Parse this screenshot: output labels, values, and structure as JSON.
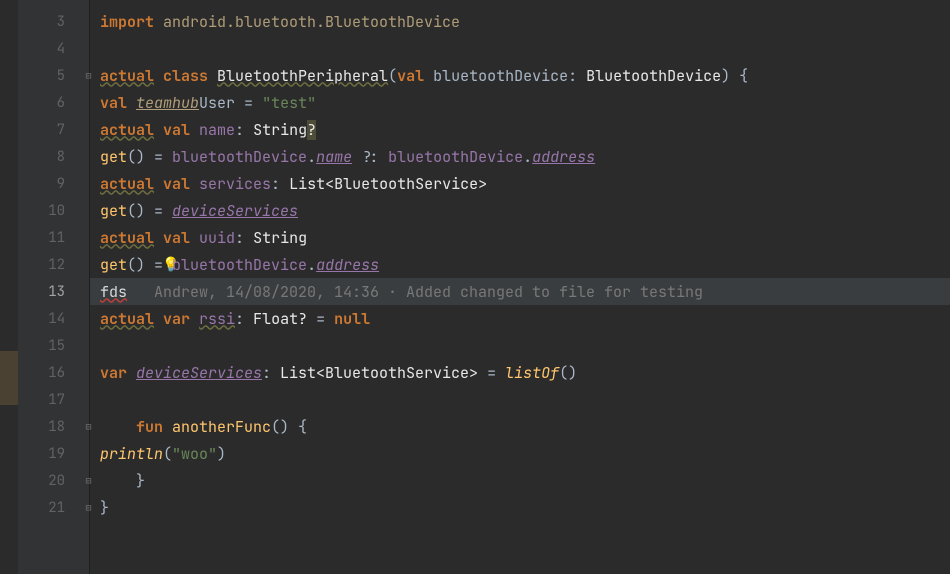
{
  "gutter": {
    "start": 3,
    "end": 21,
    "current": 13
  },
  "bulb": {
    "line": 12,
    "glyph": "💡"
  },
  "code": {
    "l3": {
      "import": "import ",
      "pkg": "android.bluetooth.BluetoothDevice"
    },
    "l5": {
      "actual": "actual",
      "class": " class ",
      "name": "BluetoothPeripheral",
      "open": "(",
      "val": "val ",
      "param": "bluetoothDevice",
      "colon": ": ",
      "type": "BluetoothDevice",
      "close": ") {"
    },
    "l6": {
      "val": "val ",
      "ident": "teamhub",
      "ident2": "User",
      "eq": " = ",
      "str": "\"test\""
    },
    "l7": {
      "actual": "actual",
      "val": " val ",
      "name": "name",
      "colon": ": ",
      "type": "String",
      "q": "?"
    },
    "l8": {
      "get": "get",
      "parens": "()",
      "eq": " = ",
      "obj": "bluetoothDevice",
      "dot": ".",
      "prop": "name",
      "elvis": " ?: ",
      "obj2": "bluetoothDevice",
      "dot2": ".",
      "prop2": "address"
    },
    "l9": {
      "actual": "actual",
      "val": " val ",
      "name": "services",
      "colon": ": ",
      "type": "List<BluetoothService>"
    },
    "l10": {
      "get": "get",
      "parens": "()",
      "eq": " = ",
      "ref": "deviceServices"
    },
    "l11": {
      "actual": "actual",
      "val": " val ",
      "name": "uuid",
      "colon": ": ",
      "type": "String"
    },
    "l12": {
      "get": "get",
      "parens": "()",
      "eq": " = ",
      "obj": "bluetoothDevice",
      "dot": ".",
      "prop": "address"
    },
    "l13": {
      "err": "fds",
      "lens": "   Andrew, 14/08/2020, 14:36 · Added changed to file for testing"
    },
    "l14": {
      "actual": "actual",
      "var": " var ",
      "name": "rssi",
      "colon": ": ",
      "type": "Float?",
      "eq": " = ",
      "null": "null"
    },
    "l16": {
      "var": "var ",
      "name": "deviceServices",
      "colon": ": ",
      "type": "List<BluetoothService>",
      "eq": " = ",
      "fn": "listOf",
      "parens": "()"
    },
    "l18": {
      "fun": "fun ",
      "name": "anotherFunc",
      "sig": "() {"
    },
    "l19": {
      "fn": "println",
      "open": "(",
      "str": "\"woo\"",
      "close": ")"
    },
    "l20": {
      "brace": "}"
    },
    "l21": {
      "brace": "}"
    }
  }
}
